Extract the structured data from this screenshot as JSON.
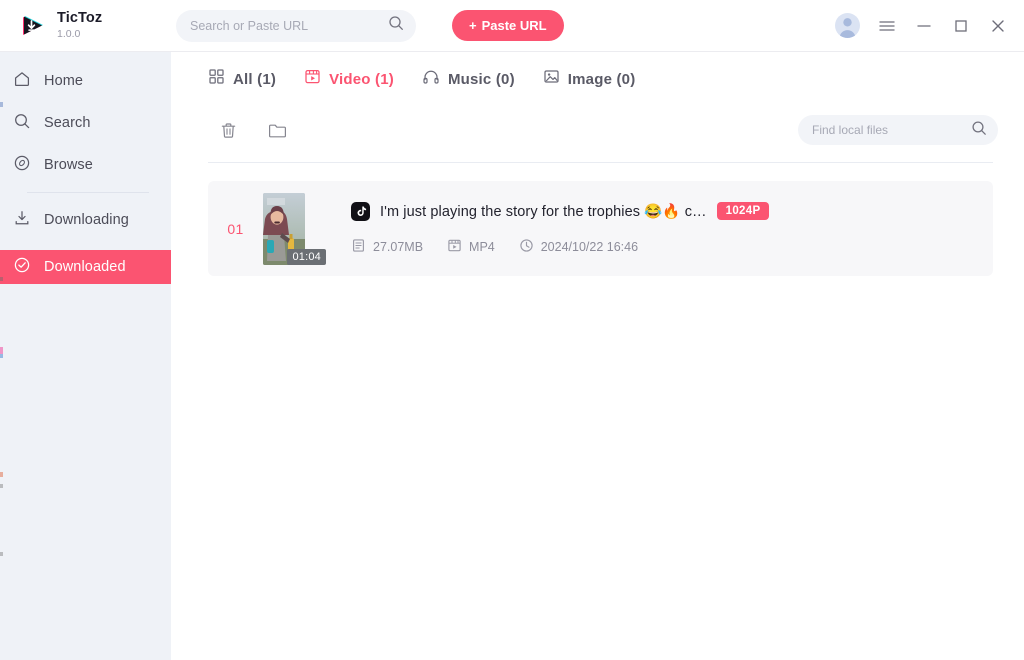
{
  "app": {
    "brand_name": "TicToz",
    "version": "1.0.0",
    "accent_color": "#fb5471",
    "sidebar_bg": "#eff2f7",
    "logo_icon": "play-download-logo"
  },
  "header": {
    "search": {
      "placeholder": "Search or Paste URL",
      "value": "",
      "icon": "search-icon"
    },
    "paste_button": {
      "label": "Paste URL",
      "plus": "+"
    },
    "avatar_icon": "user-avatar-icon",
    "menu_icon": "hamburger-menu-icon",
    "minimize_icon": "minimize-icon",
    "maximize_icon": "maximize-icon",
    "close_icon": "close-icon"
  },
  "sidebar": {
    "items": [
      {
        "label": "Home",
        "icon": "home-icon",
        "active": false
      },
      {
        "label": "Search",
        "icon": "search-icon",
        "active": false
      },
      {
        "label": "Browse",
        "icon": "compass-icon",
        "active": false
      }
    ],
    "downloads": [
      {
        "label": "Downloading",
        "icon": "download-tray-icon",
        "active": false
      },
      {
        "label": "Downloaded",
        "icon": "check-circle-icon",
        "active": true
      }
    ]
  },
  "main": {
    "tabs": [
      {
        "label": "All (1)",
        "icon": "grid-icon",
        "active": false
      },
      {
        "label": "Video (1)",
        "icon": "video-clapper-icon",
        "active": true
      },
      {
        "label": "Music (0)",
        "icon": "headphones-icon",
        "active": false
      },
      {
        "label": "Image (0)",
        "icon": "image-icon",
        "active": false
      }
    ],
    "toolbar": {
      "delete_icon": "trash-icon",
      "folder_icon": "folder-icon",
      "find": {
        "placeholder": "Find local files",
        "value": "",
        "icon": "search-icon"
      }
    },
    "rows": [
      {
        "number": "01",
        "duration": "01:04",
        "source_icon": "tiktok-icon",
        "title": "I'm just playing the story for the trophies 😂🔥 c…",
        "quality": "1024P",
        "size": "27.07MB",
        "size_icon": "file-icon",
        "format": "MP4",
        "format_icon": "video-file-icon",
        "date": "2024/10/22 16:46",
        "date_icon": "clock-icon"
      }
    ]
  }
}
